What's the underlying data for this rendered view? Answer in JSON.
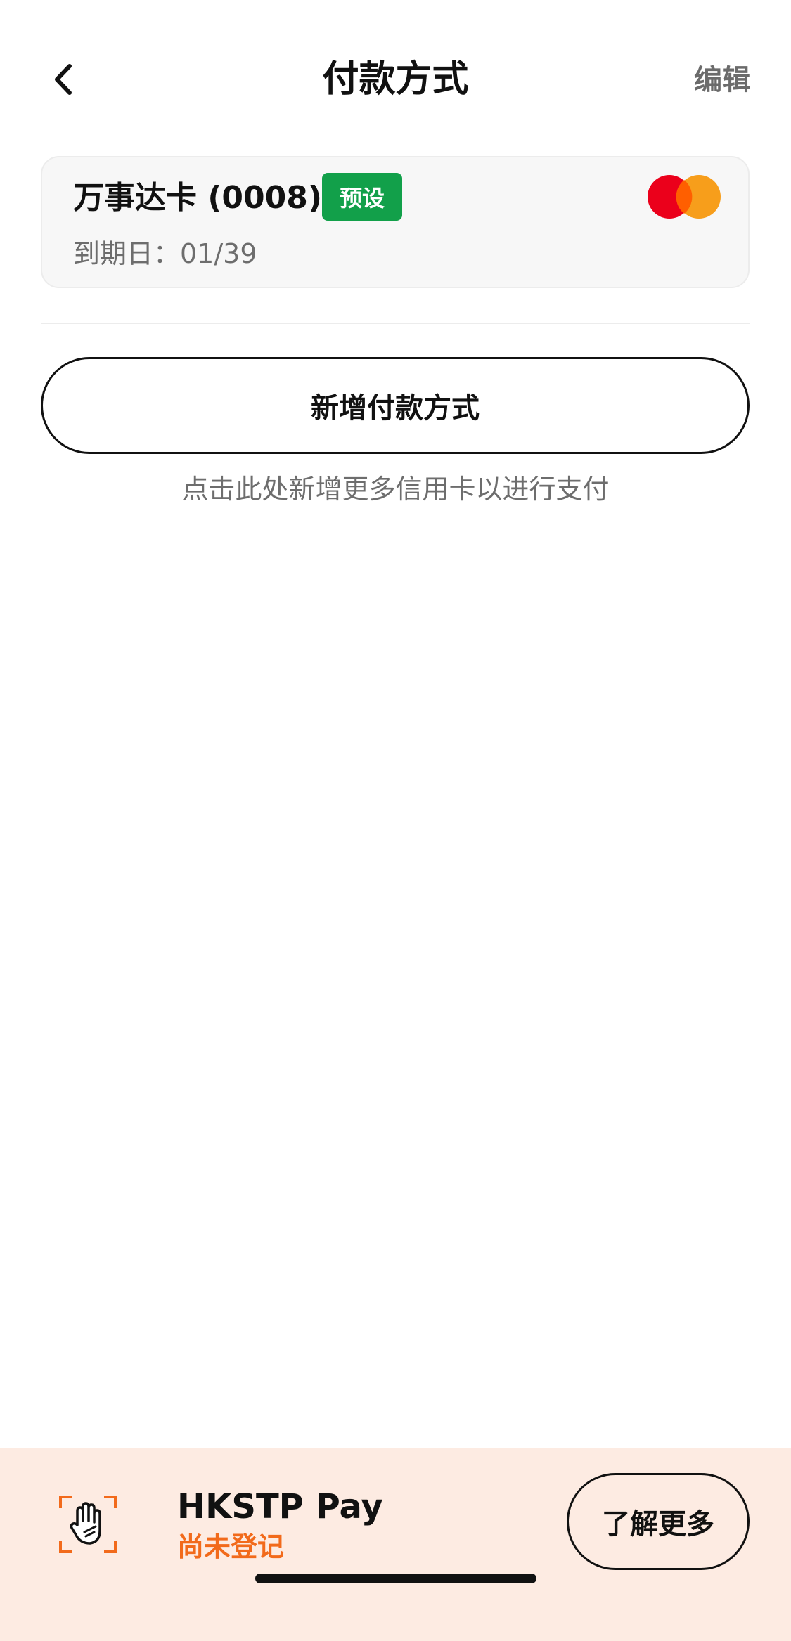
{
  "header": {
    "back_icon": "chevron-left-icon",
    "title": "付款方式",
    "edit_label": "编辑"
  },
  "card": {
    "name": "万事达卡 (0008)",
    "default_badge": "预设",
    "expiry": "到期日：01/39",
    "brand_icon": "mastercard-icon",
    "brand_colors": [
      "#eb001b",
      "#f79e1b"
    ],
    "badge_color": "#12a04a"
  },
  "add_payment": {
    "label": "新增付款方式",
    "hint": "点击此处新增更多信用卡以进行支付"
  },
  "banner": {
    "icon": "palm-scan-icon",
    "title": "HKSTP Pay",
    "status": "尚未登记",
    "status_color": "#f26a1b",
    "background": "#fdebe2",
    "learn_more_label": "了解更多"
  }
}
